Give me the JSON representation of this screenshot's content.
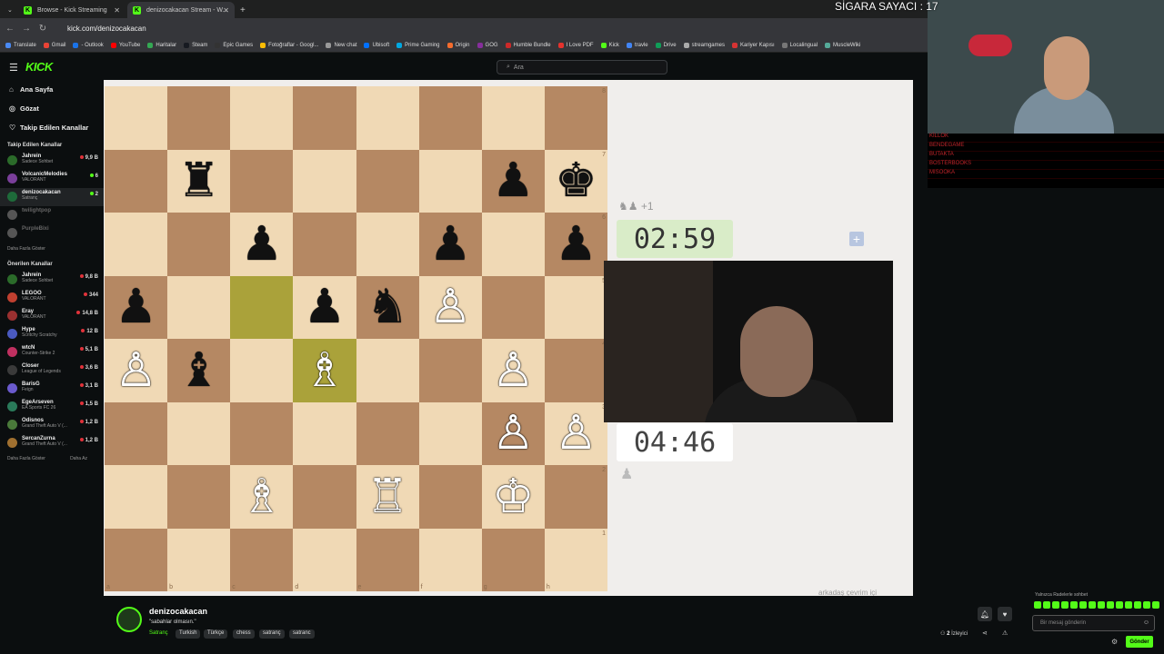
{
  "browser": {
    "tabs": [
      {
        "label": "Browse - Kick Streaming"
      },
      {
        "label": "denizocakacan Stream - W..."
      }
    ],
    "url": "kick.com/denizocakacan",
    "bookmarks": [
      "Translate",
      "Gmail",
      "- Outlook",
      "YouTube",
      "Haritalar",
      "Steam",
      "Epic Games",
      "Fotoğraflar - Googl...",
      "New chat",
      "Ubisoft",
      "Prime Gaming",
      "Origin",
      "GOG",
      "Humble Bundle",
      "I Love PDF",
      "Kick",
      "travle",
      "Drive",
      "streamgames",
      "Kariyer Kapısı",
      "Localingual",
      "MuscleWiki"
    ]
  },
  "header": {
    "logo": "KICK",
    "search_placeholder": "Ara"
  },
  "sidebar": {
    "nav": [
      {
        "label": "Ana Sayfa"
      },
      {
        "label": "Gözat"
      },
      {
        "label": "Takip Edilen Kanallar"
      }
    ],
    "followed_title": "Takip Edilen Kanallar",
    "followed": [
      {
        "name": "Jahrein",
        "game": "Sadece Sohbet",
        "viewers": "9,9 B"
      },
      {
        "name": "VolcanicMelodies",
        "game": "VALORANT",
        "viewers": "6"
      },
      {
        "name": "denizocakacan",
        "game": "Satranç",
        "viewers": "2"
      },
      {
        "name": "twilightpop",
        "game": "",
        "viewers": ""
      },
      {
        "name": "PurpleBixi",
        "game": "",
        "viewers": ""
      }
    ],
    "more_label": "Daha Fazla Göster",
    "recommended_title": "Önerilen Kanallar",
    "recommended": [
      {
        "name": "Jahrein",
        "game": "Sadece Sohbet",
        "viewers": "9,8 B"
      },
      {
        "name": "LEGOO",
        "game": "VALORANT",
        "viewers": "344"
      },
      {
        "name": "Eray",
        "game": "VALORANT",
        "viewers": "14,8 B"
      },
      {
        "name": "Hype",
        "game": "Scritchy Scratchy",
        "viewers": "12 B"
      },
      {
        "name": "wtcN",
        "game": "Counter-Strike 2",
        "viewers": "5,1 B"
      },
      {
        "name": "Closer",
        "game": "League of Legends",
        "viewers": "3,6 B"
      },
      {
        "name": "BarisG",
        "game": "Feign",
        "viewers": "3,1 B"
      },
      {
        "name": "EgeArseven",
        "game": "EA Sports FC 26",
        "viewers": "1,5 B"
      },
      {
        "name": "Odisnos",
        "game": "Grand Theft Auto V (...",
        "viewers": "1,2 B"
      },
      {
        "name": "SercanZurna",
        "game": "Grand Theft Auto V (...",
        "viewers": "1,2 B"
      }
    ],
    "more_label2": "Daha Fazla Göster",
    "less_label": "Daha Az"
  },
  "chess": {
    "ranks": [
      "8",
      "7",
      "6",
      "5",
      "4",
      "3",
      "2",
      "1"
    ],
    "files": [
      "a",
      "b",
      "c",
      "d",
      "e",
      "f",
      "g",
      "h"
    ],
    "pieces": {
      "b7": "♜",
      "g7": "♟",
      "h7": "♚",
      "c6": "♟",
      "f6": "♟",
      "h6": "♟",
      "a5": "♟",
      "d5": "♟",
      "e5": "♞",
      "f5": "♙",
      "a4": "♙",
      "b4": "♝",
      "d4": "♗",
      "g4": "♙",
      "g3": "♙",
      "h3": "♙",
      "c2": "♗",
      "e2": "♖",
      "g2": "♔"
    },
    "black_pieces": [
      "b7",
      "g7",
      "h7",
      "c6",
      "f6",
      "h6",
      "a5",
      "d5",
      "e5",
      "b4"
    ],
    "highlight": [
      "c5",
      "d4"
    ],
    "clock_top": "02:59",
    "clock_bottom": "04:46",
    "captured_top": "♞♟ +1",
    "captured_bottom": "♟",
    "friends_label": "arkadaş çevrim içi"
  },
  "overlay": {
    "counter": "SİGARA SAYACI : 17",
    "rows": [
      "KİLLOK",
      "BENDEGAME",
      "BUTAKTA",
      "BOSTERBOOKS",
      "MISOOKA"
    ]
  },
  "chat": {
    "mode": "Yalnızca Radelerle sohbet",
    "placeholder": "Bir mesaj gönderin",
    "send": "Gönder"
  },
  "stream": {
    "name": "denizocakacan",
    "title": "\"sabahlar olmasın.\"",
    "category": "Satranç",
    "tags": [
      "Turkish",
      "Türkçe",
      "chess",
      "satranç",
      "satranc"
    ],
    "viewers_count": "2",
    "viewers_label": "İzleyici"
  },
  "colors": {
    "accent": "#53fc18",
    "light_square": "#f0d9b5",
    "dark_square": "#b58863"
  }
}
